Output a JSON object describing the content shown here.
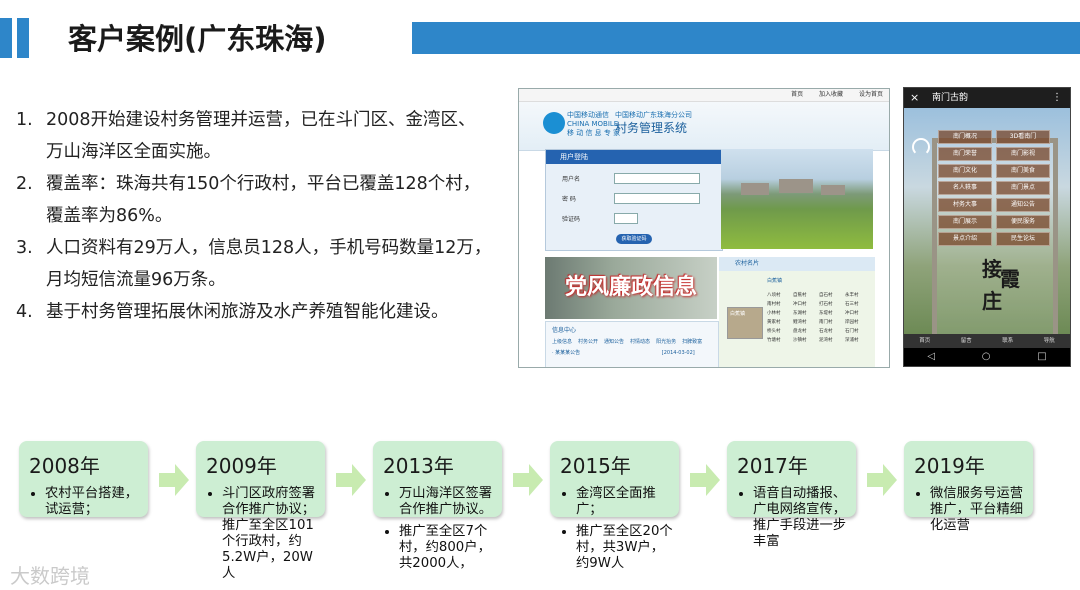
{
  "header": {
    "title": "客户案例(广东珠海)"
  },
  "bullets": [
    {
      "num": "1.",
      "lines": [
        "2008开始建设村务管理并运营，已在斗门区、金湾区、",
        "万山海洋区全面实施。"
      ]
    },
    {
      "num": "2.",
      "lines": [
        "覆盖率：珠海共有150个行政村，平台已覆盖128个村，",
        "覆盖率为86%。"
      ]
    },
    {
      "num": "3.",
      "lines": [
        "人口资料有29万人，信息员128人，手机号码数量12万，",
        "月均短信流量96万条。"
      ]
    },
    {
      "num": "4.",
      "lines": [
        "基于村务管理拓展休闲旅游及水产养殖智能化建设。"
      ]
    }
  ],
  "screenshot_portal": {
    "topbar_links": [
      "首页",
      "加入收藏",
      "设为首页"
    ],
    "logo_text": "中国移动通信",
    "logo_text_en": "CHINA MOBILE",
    "logo_slogan": "移 动 信 息 专 家",
    "company": "中国移动广东珠海分公司",
    "system_name": "村务管理系统",
    "login_header": "用户登陆",
    "username_label": "用户名",
    "password_label": "密  码",
    "captcha_label": "验证码",
    "captcha_button": "获取验证码",
    "news_banner": "党风廉政信息",
    "info_center": "信息中心",
    "info_tabs": [
      "上级信息",
      "村务公开",
      "通知公告",
      "村情动态",
      "阳光抬务",
      "扫脾致富"
    ],
    "info_item": "· 某某某公告",
    "info_date": "[2014-03-02]",
    "side_header": "农村名片",
    "side_sub": "白蕉镇",
    "villages": [
      "八顷村",
      "自蕉村",
      "自石村",
      "永丰村",
      "南村村",
      "冲口村",
      "打石村",
      "石三村",
      "小林村",
      "东湖村",
      "东堤村",
      "冲口村",
      "黄家村",
      "鲤湾村",
      "南门村",
      "岸园村",
      "桥头村",
      "盘龙村",
      "石龙村",
      "石门村",
      "竹塘村",
      "沙镇村",
      "泥湾村",
      "深浦村"
    ],
    "thumb_label": "白蕉镇"
  },
  "screenshot_app": {
    "title": "南门古韵",
    "close_icon": "×",
    "more_icon": "⋮",
    "buttons": [
      "南门概况",
      "3D看南门",
      "南门荣誉",
      "南门影视",
      "南门文化",
      "南门美食",
      "名人轶事",
      "南门景点",
      "村务大事",
      "通知公告",
      "南门展示",
      "便民服务",
      "景点介绍",
      "民生论坛"
    ],
    "sign_text": [
      "接",
      "霞",
      "庄"
    ],
    "nav_items": [
      "首页",
      "留言",
      "联系",
      "导航"
    ],
    "sys_nav": [
      "◁",
      "○",
      "□"
    ]
  },
  "timeline": [
    {
      "year": "2008年",
      "items": [
        "农村平台搭建，试运营；"
      ]
    },
    {
      "year": "2009年",
      "items": [
        "斗门区政府签署合作推广协议；推广至全区101个行政村，约5.2W户，20W人"
      ]
    },
    {
      "year": "2013年",
      "items": [
        "万山海洋区签署合作推广协议。",
        "推广至全区7个村，约800户，共2000人，"
      ]
    },
    {
      "year": "2015年",
      "items": [
        "金湾区全面推广；",
        "推广至全区20个村，共3W户，约9W人"
      ]
    },
    {
      "year": "2017年",
      "items": [
        "语音自动播报、广电网络宣传，推广手段进一步丰富"
      ]
    },
    {
      "year": "2019年",
      "items": [
        "微信服务号运营推广，平台精细化运营"
      ]
    }
  ],
  "watermark": "大数跨境",
  "colors": {
    "accent_blue": "#2e86c9",
    "timeline_box": "#cdeed3",
    "timeline_arrow": "#c8ebb0"
  }
}
